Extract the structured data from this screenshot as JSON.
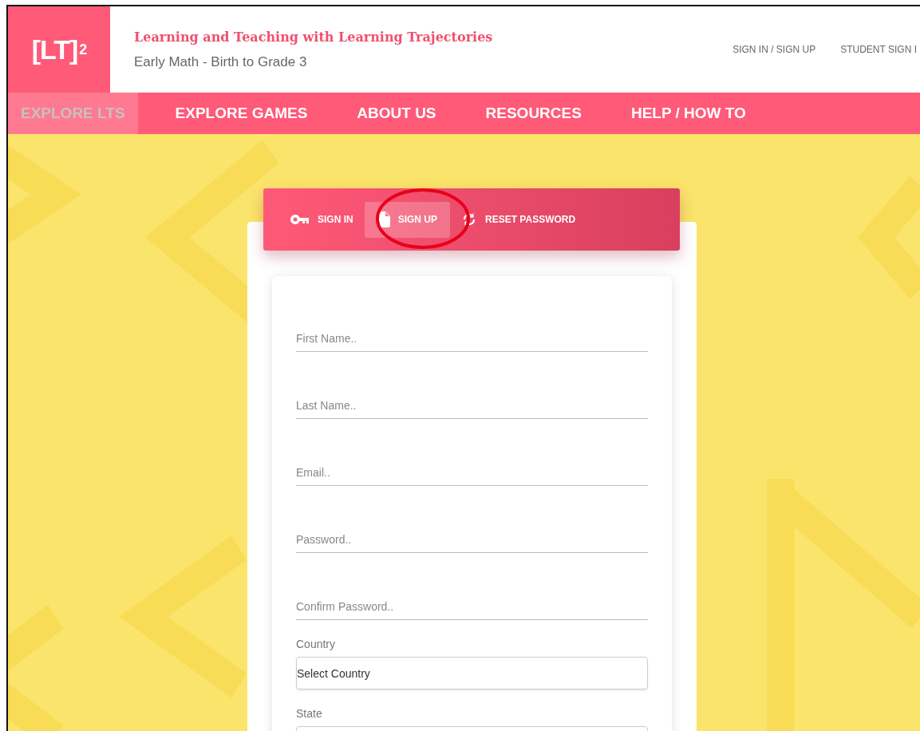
{
  "header": {
    "logo": {
      "text": "[LT]",
      "superscript": "2"
    },
    "title": "Learning and Teaching with Learning Trajectories",
    "subtitle": "Early Math - Birth to Grade 3",
    "links": [
      "SIGN IN / SIGN UP",
      "STUDENT SIGN I"
    ]
  },
  "nav": [
    {
      "label": "EXPLORE LTS",
      "selected": true
    },
    {
      "label": "EXPLORE GAMES",
      "selected": false
    },
    {
      "label": "ABOUT US",
      "selected": false
    },
    {
      "label": "RESOURCES",
      "selected": false
    },
    {
      "label": "HELP / HOW TO",
      "selected": false
    }
  ],
  "tabs": [
    {
      "label": "SIGN IN",
      "kind": "key",
      "selected": false
    },
    {
      "label": "SIGN UP",
      "kind": "document",
      "selected": true
    },
    {
      "label": "RESET PASSWORD",
      "kind": "refresh",
      "selected": false
    }
  ],
  "form": [
    {
      "kind": "underline",
      "placeholder": "First Name.."
    },
    {
      "kind": "underline",
      "placeholder": "Last Name.."
    },
    {
      "kind": "underline",
      "placeholder": "Email.."
    },
    {
      "kind": "underline",
      "placeholder": "Password.."
    },
    {
      "kind": "underline",
      "placeholder": "Confirm Password.."
    },
    {
      "kind": "select",
      "label": "Country",
      "value": "Select Country"
    },
    {
      "kind": "select",
      "label": "State"
    }
  ]
}
